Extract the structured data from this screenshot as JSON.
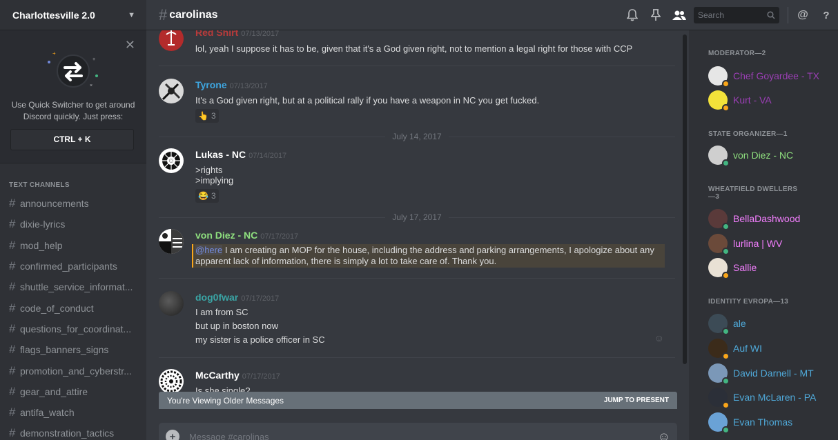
{
  "server": {
    "name": "Charlottesville 2.0"
  },
  "quick_switcher": {
    "text": "Use Quick Switcher to get around Discord quickly. Just press:",
    "shortcut": "CTRL + K"
  },
  "sidebar": {
    "section": "TEXT CHANNELS",
    "channels": [
      "announcements",
      "dixie-lyrics",
      "mod_help",
      "confirmed_participants",
      "shuttle_service_informat...",
      "code_of_conduct",
      "questions_for_coordinat...",
      "flags_banners_signs",
      "promotion_and_cyberstr...",
      "gear_and_attire",
      "antifa_watch",
      "demonstration_tactics"
    ]
  },
  "channel": {
    "name": "carolinas"
  },
  "toolbar": {
    "search_placeholder": "Search"
  },
  "messages": [
    {
      "author": "Red Shirt",
      "color": "#b93b3b",
      "time": "07/13/2017",
      "lines": [
        "lol,  yeah I suppose it has to be, given that it's a God given right, not to mention a legal right for those with CCP"
      ]
    },
    {
      "author": "Tyrone",
      "color": "#3ea6e0",
      "time": "07/13/2017",
      "lines": [
        "It's a God given right, but at a political rally if you have a weapon in NC you get fucked."
      ],
      "reaction": {
        "emoji": "👆",
        "count": "3"
      }
    },
    {
      "author": "Lukas - NC",
      "color": "#ffffff",
      "time": "07/14/2017",
      "lines": [
        ">rights",
        ">implying"
      ],
      "reaction": {
        "emoji": "😂",
        "count": "3"
      }
    },
    {
      "author": "von Diez - NC",
      "color": "#8fe07f",
      "time": "07/17/2017",
      "mention": "@here",
      "lines": [
        "I am creating an MOP for the house, including the address and parking arrangements, I apologize about any",
        "apparent lack of information, there is simply a lot to take care of. Thank you."
      ]
    },
    {
      "author": "dog0fwar",
      "color": "#3aa6a6",
      "time": "07/17/2017",
      "lines": [
        "I am from SC",
        "but up in boston now",
        "my sister is a police officer in SC"
      ]
    },
    {
      "author": "McCarthy",
      "color": "#ffffff",
      "time": "07/17/2017",
      "lines": [
        "Is she single?"
      ]
    }
  ],
  "dates": [
    "July 14, 2017",
    "July 17, 2017"
  ],
  "older_bar": {
    "text": "You're Viewing Older Messages",
    "jump": "JUMP TO PRESENT"
  },
  "composer": {
    "placeholder": "Message #carolinas"
  },
  "members": {
    "roles": [
      {
        "name": "MODERATOR—2"
      },
      {
        "name": "STATE ORGANIZER—1"
      },
      {
        "name": "WHEATFIELD DWELLERS—3"
      },
      {
        "name": "IDENTITY EVROPA—13"
      }
    ],
    "list": [
      {
        "name": "Chef Goyardee - TX",
        "color": "#9b3fb5",
        "status": "#faa61a"
      },
      {
        "name": "Kurt - VA",
        "color": "#9b3fb5",
        "status": "#faa61a"
      },
      {
        "name": "von Diez - NC",
        "color": "#8fe07f",
        "status": "#43b581"
      },
      {
        "name": "BellaDashwood",
        "color": "#f47fff",
        "status": "#43b581"
      },
      {
        "name": "lurlina | WV",
        "color": "#f47fff",
        "status": "#43b581"
      },
      {
        "name": "Sallie",
        "color": "#f47fff",
        "status": "#faa61a"
      },
      {
        "name": "ale",
        "color": "#4fa9d9",
        "status": "#43b581"
      },
      {
        "name": "Auf WI",
        "color": "#4fa9d9",
        "status": "#faa61a"
      },
      {
        "name": "David Darnell - MT",
        "color": "#4fa9d9",
        "status": "#43b581"
      },
      {
        "name": "Evan McLaren - PA",
        "color": "#4fa9d9",
        "status": "#faa61a"
      },
      {
        "name": "Evan Thomas",
        "color": "#4fa9d9",
        "status": "#43b581"
      }
    ]
  }
}
